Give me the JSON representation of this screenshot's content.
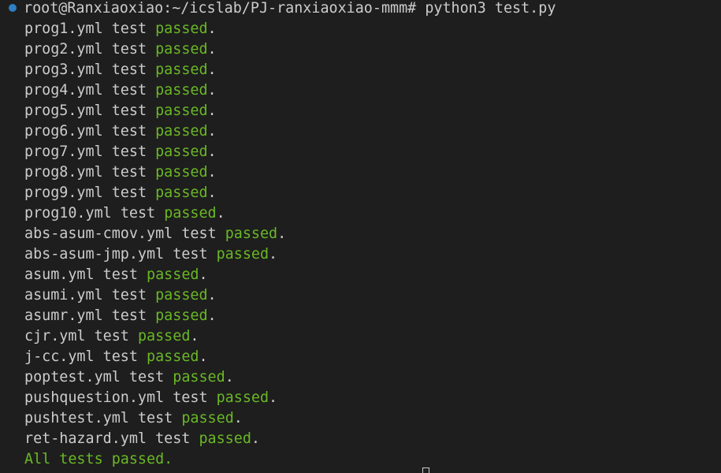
{
  "terminal": {
    "prompt": "root@Ranxiaoxiao:~/icslab/PJ-ranxiaoxiao-mmm# python3 test.py",
    "results": [
      {
        "file": "prog1.yml",
        "word": "test",
        "status": "passed",
        "end": "."
      },
      {
        "file": "prog2.yml",
        "word": "test",
        "status": "passed",
        "end": "."
      },
      {
        "file": "prog3.yml",
        "word": "test",
        "status": "passed",
        "end": "."
      },
      {
        "file": "prog4.yml",
        "word": "test",
        "status": "passed",
        "end": "."
      },
      {
        "file": "prog5.yml",
        "word": "test",
        "status": "passed",
        "end": "."
      },
      {
        "file": "prog6.yml",
        "word": "test",
        "status": "passed",
        "end": "."
      },
      {
        "file": "prog7.yml",
        "word": "test",
        "status": "passed",
        "end": "."
      },
      {
        "file": "prog8.yml",
        "word": "test",
        "status": "passed",
        "end": "."
      },
      {
        "file": "prog9.yml",
        "word": "test",
        "status": "passed",
        "end": "."
      },
      {
        "file": "prog10.yml",
        "word": "test",
        "status": "passed",
        "end": "."
      },
      {
        "file": "abs-asum-cmov.yml",
        "word": "test",
        "status": "passed",
        "end": "."
      },
      {
        "file": "abs-asum-jmp.yml",
        "word": "test",
        "status": "passed",
        "end": "."
      },
      {
        "file": "asum.yml",
        "word": "test",
        "status": "passed",
        "end": "."
      },
      {
        "file": "asumi.yml",
        "word": "test",
        "status": "passed",
        "end": "."
      },
      {
        "file": "asumr.yml",
        "word": "test",
        "status": "passed",
        "end": "."
      },
      {
        "file": "cjr.yml",
        "word": "test",
        "status": "passed",
        "end": "."
      },
      {
        "file": "j-cc.yml",
        "word": "test",
        "status": "passed",
        "end": "."
      },
      {
        "file": "poptest.yml",
        "word": "test",
        "status": "passed",
        "end": "."
      },
      {
        "file": "pushquestion.yml",
        "word": "test",
        "status": "passed",
        "end": "."
      },
      {
        "file": "pushtest.yml",
        "word": "test",
        "status": "passed",
        "end": "."
      },
      {
        "file": "ret-hazard.yml",
        "word": "test",
        "status": "passed",
        "end": "."
      }
    ],
    "summary": "All tests passed.",
    "colors": {
      "background": "#1e1e1e",
      "text": "#cccccc",
      "passed": "#6ab825",
      "prompt_dot": "#2f7fc1"
    }
  }
}
